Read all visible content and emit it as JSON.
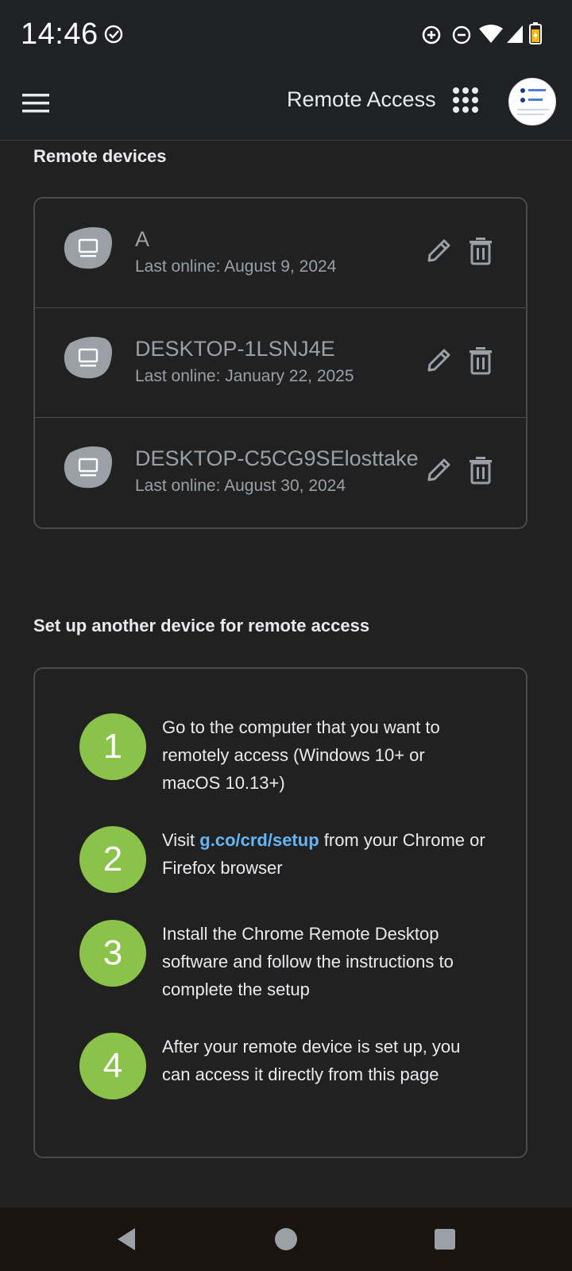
{
  "status_bar": {
    "time": "14:46",
    "icons": [
      "check-circle-icon",
      "data-saver-icon",
      "do-not-disturb-icon",
      "wifi-icon",
      "signal-icon",
      "battery-icon"
    ]
  },
  "app_bar": {
    "title": "Remote Access",
    "icons": [
      "menu-icon",
      "apps-grid-icon",
      "avatar"
    ]
  },
  "remote_devices": {
    "title": "Remote devices",
    "devices": [
      {
        "name": "A",
        "last_online": "Last online: August 9, 2024"
      },
      {
        "name": "DESKTOP-1LSNJ4E",
        "last_online": "Last online: January 22, 2025"
      },
      {
        "name": "DESKTOP-C5CG9SElosttake",
        "last_online": "Last online: August 30, 2024"
      }
    ]
  },
  "setup": {
    "title": "Set up another device for remote access",
    "steps": [
      {
        "number": "1",
        "text": "Go to the computer that you want to remotely access (Windows 10+ or macOS 10.13+)"
      },
      {
        "number": "2",
        "prefix": "Visit ",
        "link": "g.co/crd/setup",
        "suffix": " from your Chrome or Firefox browser"
      },
      {
        "number": "3",
        "text": "Install the Chrome Remote Desktop software and follow the instructions to complete the setup"
      },
      {
        "number": "4",
        "text": "After your remote device is set up, you can access it directly from this page"
      }
    ]
  },
  "nav_bar": {
    "icons": [
      "back-icon",
      "home-icon",
      "recents-icon"
    ]
  },
  "colors": {
    "background": "#212121",
    "accent_green": "#8bc34a",
    "link_blue": "#64b5f6",
    "muted_text": "#9aa0a6"
  }
}
